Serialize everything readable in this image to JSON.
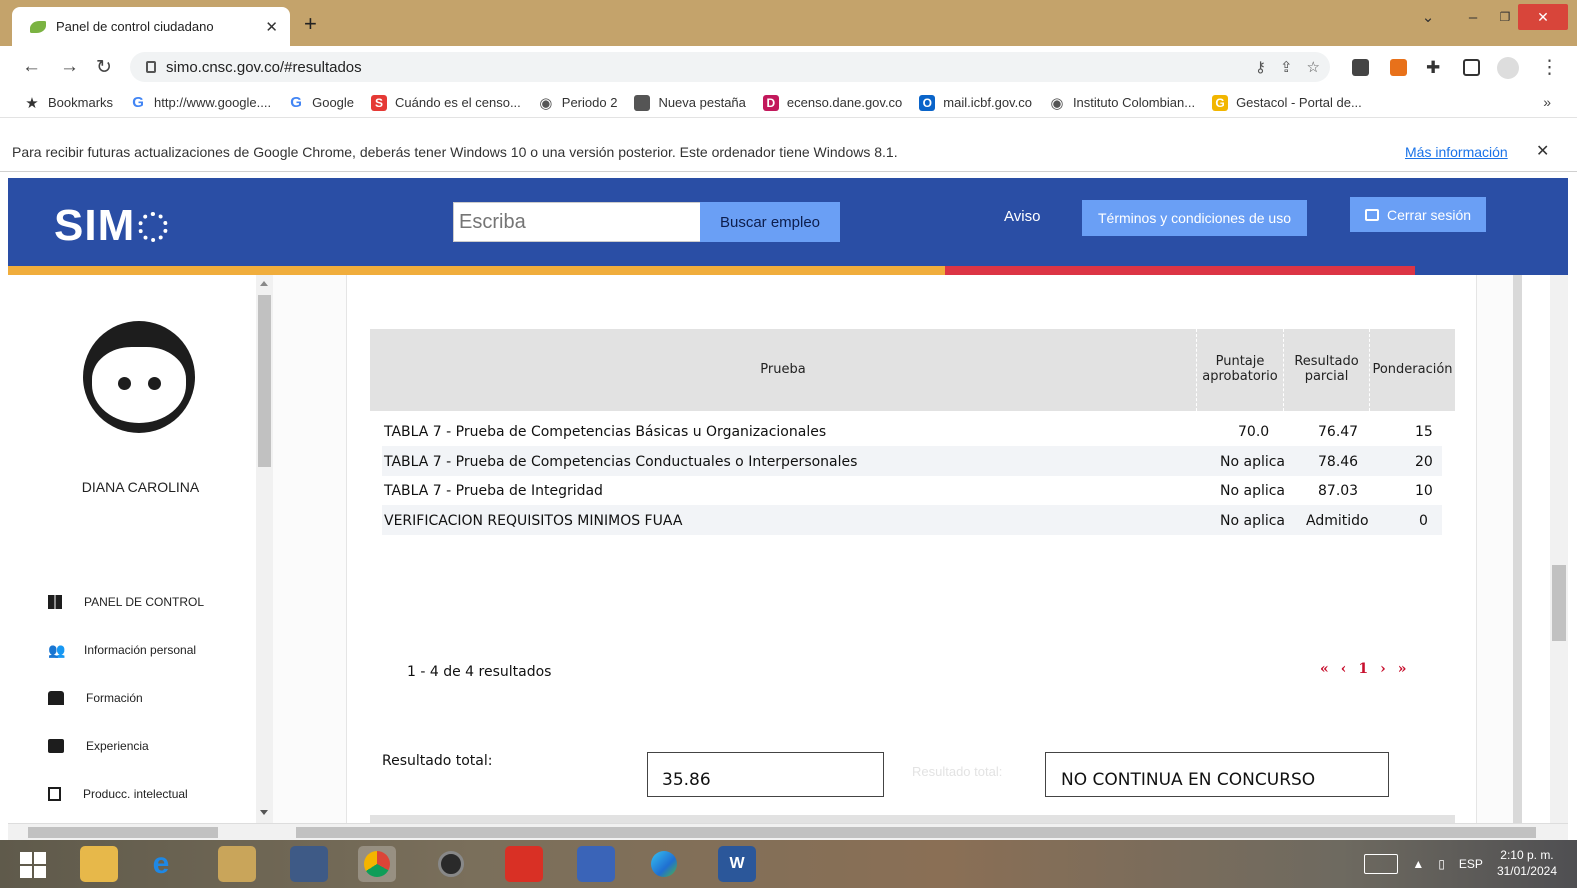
{
  "browser": {
    "tab_title": "Panel de control ciudadano",
    "url": "simo.cnsc.gov.co/#resultados",
    "bookmarks": [
      {
        "label": "Bookmarks",
        "icon": "star-icon",
        "color": "#333333"
      },
      {
        "label": "http://www.google....",
        "icon": "google-icon",
        "color": "#4285f4"
      },
      {
        "label": "Google",
        "icon": "google-icon",
        "color": "#4285f4"
      },
      {
        "label": "Cuándo es el censo...",
        "icon": "s-icon",
        "color": "#e53935"
      },
      {
        "label": "Periodo 2",
        "icon": "globe-icon",
        "color": "#555555"
      },
      {
        "label": "Nueva pestaña",
        "icon": "page-icon",
        "color": "#555555"
      },
      {
        "label": "ecenso.dane.gov.co",
        "icon": "dane-icon",
        "color": "#c2185b"
      },
      {
        "label": "mail.icbf.gov.co",
        "icon": "outlook-icon",
        "color": "#0a64c9"
      },
      {
        "label": "Instituto Colombian...",
        "icon": "globe-icon",
        "color": "#555555"
      },
      {
        "label": "Gestacol - Portal de...",
        "icon": "gestacol-icon",
        "color": "#f2b600"
      }
    ],
    "infobar": {
      "message": "Para recibir futuras actualizaciones de Google Chrome, deberás tener Windows 10 o una versión posterior. Este ordenador tiene Windows 8.1.",
      "link": "Más información"
    }
  },
  "header": {
    "logo": "SIM",
    "search_placeholder": "Escriba",
    "search_button": "Buscar empleo",
    "aviso": "Aviso",
    "terms": "Términos y condiciones de uso",
    "logout": "Cerrar sesión",
    "stripe_colors": [
      "#f0ad3c",
      "#dc3545",
      "#2a4ea5"
    ]
  },
  "sidebar": {
    "user_name": "DIANA CAROLINA",
    "menu": [
      {
        "label": "PANEL DE CONTROL",
        "icon": "dashboard-icon"
      },
      {
        "label": "Información personal",
        "icon": "people-icon"
      },
      {
        "label": "Formación",
        "icon": "reading-icon"
      },
      {
        "label": "Experiencia",
        "icon": "briefcase-icon"
      },
      {
        "label": "Producc. intelectual",
        "icon": "document-icon"
      }
    ]
  },
  "results": {
    "headers": {
      "prueba": "Prueba",
      "puntaje_1": "Puntaje",
      "puntaje_2": "aprobatorio",
      "resultado_1": "Resultado",
      "resultado_2": "parcial",
      "ponderacion": "Ponderación"
    },
    "rows": [
      {
        "prueba": "TABLA 7 - Prueba de Competencias Básicas u Organizacionales",
        "puntaje": "70.0",
        "resultado": "76.47",
        "ponderacion": "15"
      },
      {
        "prueba": "TABLA 7 - Prueba de Competencias Conductuales o Interpersonales",
        "puntaje": "No aplica",
        "resultado": "78.46",
        "ponderacion": "20"
      },
      {
        "prueba": "TABLA 7 - Prueba de Integridad",
        "puntaje": "No aplica",
        "resultado": "87.03",
        "ponderacion": "10"
      },
      {
        "prueba": "VERIFICACION REQUISITOS MINIMOS FUAA",
        "puntaje": "No aplica",
        "resultado": "Admitido",
        "ponderacion": "0"
      }
    ],
    "pager_text": "1 - 4 de 4 resultados",
    "pager": {
      "first": "«",
      "prev": "‹",
      "page": "1",
      "next": "›",
      "last": "»"
    },
    "total_label": "Resultado total:",
    "total_value": "35.86",
    "ghost_label": "Resultado total:",
    "status": "NO CONTINUA EN CONCURSO"
  },
  "taskbar": {
    "lang": "ESP",
    "time": "2:10 p. m.",
    "date": "31/01/2024"
  }
}
